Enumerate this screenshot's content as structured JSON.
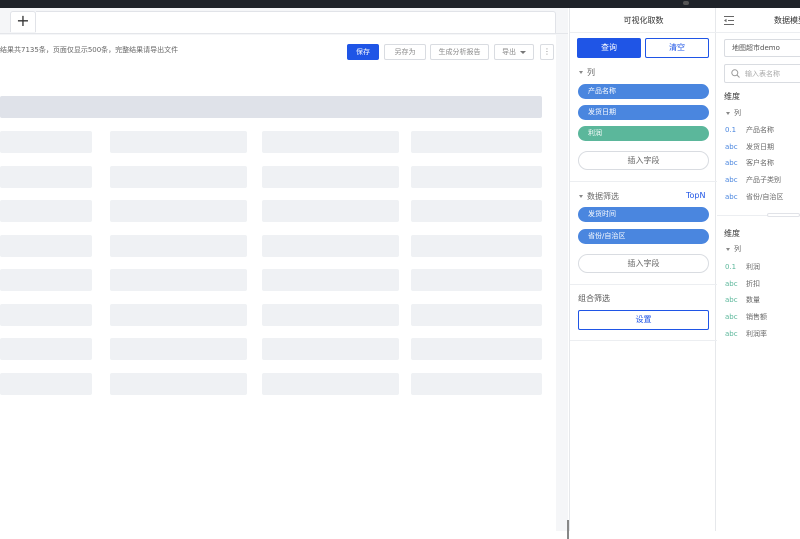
{
  "toolbar": {
    "notice": "结果共7135条，页面仅显示500条，完整结果请导出文件",
    "save": "保存",
    "save_as": "另存为",
    "gen_report": "生成分析报告",
    "export": "导出",
    "more": "⋮"
  },
  "tabs": {
    "add": "+"
  },
  "panel": {
    "title": "可视化取数",
    "query": "查询",
    "clear": "清空",
    "columns_section": "列",
    "column_pills": [
      {
        "label": "产品名称",
        "color": "blue"
      },
      {
        "label": "发货日期",
        "color": "blue"
      },
      {
        "label": "利润",
        "color": "green"
      }
    ],
    "insert_field": "插入字段",
    "filter_section": "数据筛选",
    "topn": "TopN",
    "filter_pills": [
      {
        "label": "发货时间",
        "color": "blue"
      },
      {
        "label": "省份/自治区",
        "color": "blue"
      }
    ],
    "insert_field_2": "插入字段",
    "combo_filter": "组合筛选",
    "settings": "设置"
  },
  "model": {
    "title": "数据模型",
    "dataset": "地图超市demo",
    "search_placeholder": "输入表名称",
    "dimensions": {
      "title": "维度",
      "sub": "列",
      "fields": [
        {
          "type": "0.1",
          "name": "产品名称",
          "color": "blue"
        },
        {
          "type": "abc",
          "name": "发货日期",
          "color": "blue"
        },
        {
          "type": "abc",
          "name": "客户名称",
          "color": "blue"
        },
        {
          "type": "abc",
          "name": "产品子类别",
          "color": "blue"
        },
        {
          "type": "abc",
          "name": "省份/自治区",
          "color": "blue"
        }
      ]
    },
    "measures": {
      "title": "维度",
      "sub": "列",
      "fields": [
        {
          "type": "0.1",
          "name": "利润",
          "color": "green"
        },
        {
          "type": "abc",
          "name": "折扣",
          "color": "green"
        },
        {
          "type": "abc",
          "name": "数量",
          "color": "green"
        },
        {
          "type": "abc",
          "name": "销售额",
          "color": "green"
        },
        {
          "type": "abc",
          "name": "利润率",
          "color": "green"
        }
      ]
    }
  },
  "colors": {
    "primary": "#1f55e6",
    "pill_blue": "#4a86df",
    "pill_green": "#5bb79b"
  }
}
